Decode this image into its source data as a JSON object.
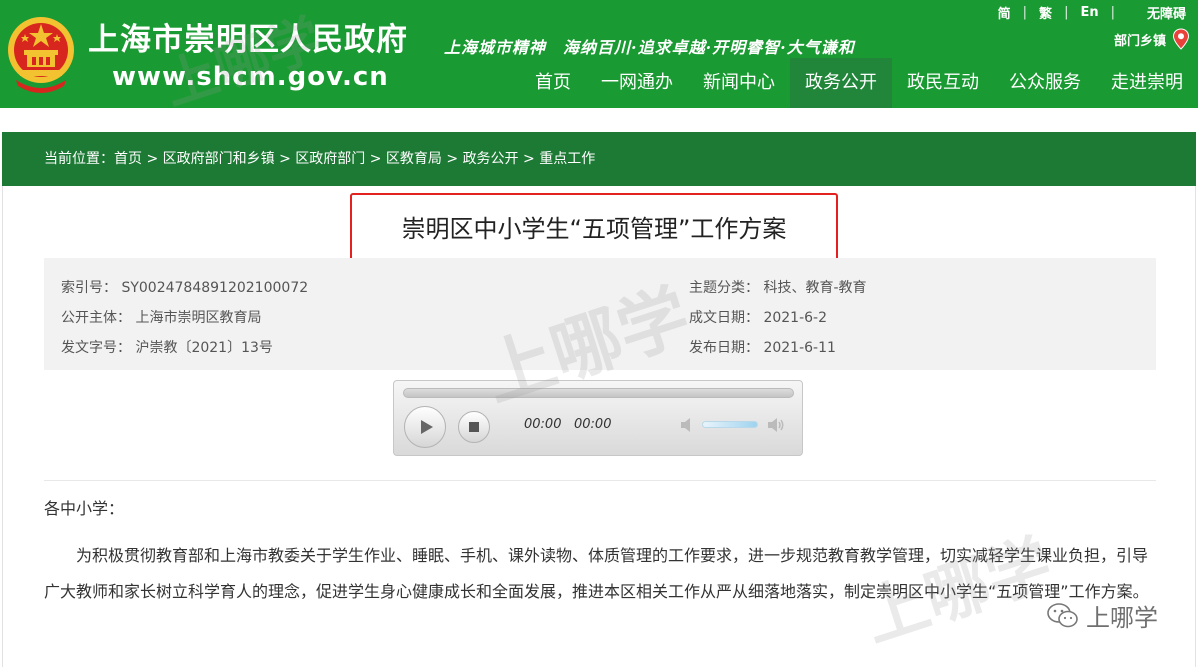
{
  "header": {
    "site_name": "上海市崇明区人民政府",
    "site_url": "www.shcm.gov.cn",
    "slogan": "上海城市精神　海纳百川·追求卓越·开明睿智·大气谦和",
    "lang_links": [
      "简",
      "繁",
      "En"
    ],
    "accessibility": "无障碍",
    "township": "部门乡镇",
    "nav": [
      "首页",
      "一网通办",
      "新闻中心",
      "政务公开",
      "政民互动",
      "公众服务",
      "走进崇明"
    ],
    "nav_active": "政务公开",
    "brand_color": "#1a9a32"
  },
  "breadcrumb": {
    "prefix": "当前位置：",
    "items": [
      "首页",
      "区政府部门和乡镇",
      "区政府部门",
      "区教育局",
      "政务公开",
      "重点工作"
    ],
    "separator": " > "
  },
  "article": {
    "title": "崇明区中小学生“五项管理”工作方案",
    "meta": {
      "index_label": "索引号：",
      "index_value": "SY0024784891202100072",
      "publisher_label": "公开主体：",
      "publisher_value": "上海市崇明区教育局",
      "doc_no_label": "发文字号：",
      "doc_no_value": "沪崇教〔2021〕13号",
      "topic_label": "主题分类：",
      "topic_value": "科技、教育-教育",
      "created_label": "成文日期：",
      "created_value": "2021-6-2",
      "published_label": "发布日期：",
      "published_value": "2021-6-11"
    },
    "greeting": "各中小学：",
    "paragraph": "为积极贯彻教育部和上海市教委关于学生作业、睡眠、手机、课外读物、体质管理的工作要求，进一步规范教育教学管理，切实减轻学生课业负担，引导广大教师和家长树立科学育人的理念，促进学生身心健康成长和全面发展，推进本区相关工作从严从细落地落实，制定崇明区中小学生“五项管理”工作方案。"
  },
  "player": {
    "current_time": "00:00",
    "duration": "00:00",
    "progress": 0
  },
  "watermark": {
    "text": "上哪学"
  }
}
